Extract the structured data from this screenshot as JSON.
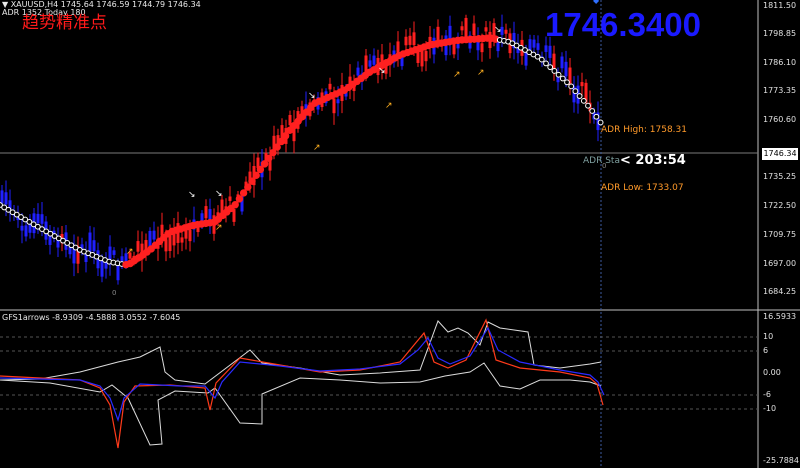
{
  "header": {
    "title": "▼ XAUUSD,H4  1745.64 1746.59 1744.79 1746.34",
    "adr_info": "ADR 1352  Today 180",
    "indicator_caption": "趋势精准点",
    "big_price": "1746.3400",
    "top_marker": "◆"
  },
  "adr": {
    "high_label": "ADR High: 1758.31",
    "low_label": "ADR Low: 1733.07",
    "start_label": "ADR Sta",
    "countdown": "< 203:54"
  },
  "price_axis": {
    "labels": [
      "1811.50",
      "1798.85",
      "1786.10",
      "1773.35",
      "1760.60",
      "1746.34",
      "1735.25",
      "1722.50",
      "1709.75",
      "1697.00",
      "1684.25"
    ],
    "current_price": "1746.34"
  },
  "indicator": {
    "title": "GFS1arrows -8.9309 -4.5888 3.0552 -7.6045",
    "axis_labels": [
      "16.5933",
      "6",
      "0.00",
      "-6",
      "-10",
      "-25.7884"
    ],
    "extra_label": "10"
  },
  "misc": {
    "bottom_left_marker": "0",
    "right_marker": "0"
  },
  "colors": {
    "bull": "#ff2020",
    "bear": "#2020ff",
    "trend_red": "#ff2020",
    "trend_white": "#ffffff",
    "arrow_yellow": "#ffb020",
    "arrow_white": "#ffffff",
    "adr_orange": "#ff9a2a"
  }
}
